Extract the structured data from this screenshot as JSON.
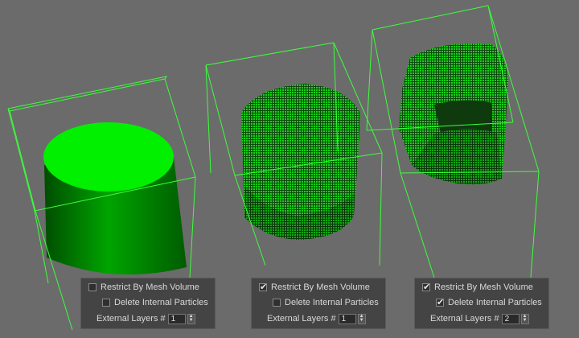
{
  "scene": {
    "colors": {
      "background": "#6b6b6b",
      "wireframe": "#3cff3c",
      "solid_top": "#00f000",
      "solid_side": "#009a00",
      "particles": "#14c814"
    },
    "objects": [
      "solid-cylinder",
      "particle-cylinder",
      "particle-chair"
    ]
  },
  "panels": [
    {
      "restrict_label": "Restrict By Mesh Volume",
      "restrict_checked": false,
      "delete_label": "Delete Internal Particles",
      "delete_checked": false,
      "layers_label": "External Layers #",
      "layers_value": "1"
    },
    {
      "restrict_label": "Restrict By Mesh Volume",
      "restrict_checked": true,
      "delete_label": "Delete Internal Particles",
      "delete_checked": false,
      "layers_label": "External Layers #",
      "layers_value": "1"
    },
    {
      "restrict_label": "Restrict By Mesh Volume",
      "restrict_checked": true,
      "delete_label": "Delete Internal Particles",
      "delete_checked": true,
      "layers_label": "External Layers #",
      "layers_value": "2"
    }
  ]
}
